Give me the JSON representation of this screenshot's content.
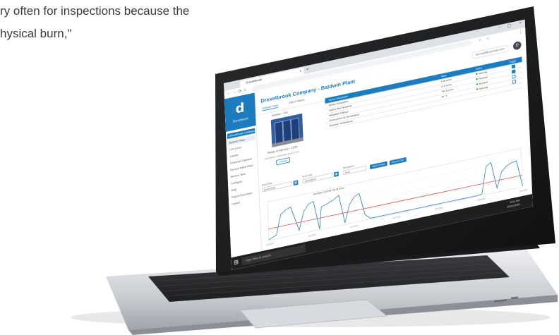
{
  "quote": {
    "line1": "ry often for inspections because the",
    "line2": "hysical burn,\""
  },
  "browser": {
    "tab_title": "DrexelBrook",
    "close_tab": "×",
    "new_tab": "+",
    "window_controls": [
      "–",
      "▢",
      "×"
    ]
  },
  "header": {
    "user": "account@domain.com",
    "avatar_initial": "D"
  },
  "sidebar": {
    "brand": "Drexelbrook",
    "items": [
      {
        "label": "Drexelbrook Company",
        "state": "active"
      },
      {
        "label": "Baldwin Plant",
        "state": "sub"
      },
      {
        "label": "Unit Level",
        "state": "normal"
      },
      {
        "label": "Liquids",
        "state": "normal"
      },
      {
        "label": "Universal Cabinets",
        "state": "normal"
      },
      {
        "label": "Service Panel Plant",
        "state": "normal"
      },
      {
        "label": "Service Tank",
        "state": "normal"
      },
      {
        "label": "Configure",
        "state": "normal"
      },
      {
        "label": "Help",
        "state": "normal"
      },
      {
        "label": "Report Document",
        "state": "normal"
      },
      {
        "label": "Logout",
        "state": "normal"
      }
    ]
  },
  "page": {
    "title": "Drexelbrook Company - Baldwin Plant",
    "tabs": [
      "Baldwin Plant",
      "Alarm History"
    ]
  },
  "photo": {
    "label": "Baldwin - 400",
    "caption": "Rows of Service - 1234",
    "subcaption": "Last Refresh: 10/21/2020 10:52:17 PM",
    "button": "Refresh"
  },
  "table": {
    "headers": [
      "Sensor Description",
      "Value",
      "Status",
      "Toggle"
    ],
    "rows": [
      {
        "name": "Sensor Description",
        "value": "6.38 kV/m",
        "status": "Nominal",
        "checked": true
      },
      {
        "name": "Carbon Bed Temperat.",
        "value": "6.37 kV/m",
        "status": "Nominal",
        "checked": true
      },
      {
        "name": "Weighted Pollution",
        "value": "760 Cu/mm",
        "status": "Nominal",
        "checked": false
      },
      {
        "name": "Environment Air Temperature",
        "value": "90 °F",
        "status": "Nominal",
        "checked": false
      },
      {
        "name": "Elevation Temperature",
        "value": "",
        "status": "",
        "checked": false
      }
    ]
  },
  "filters": {
    "start_label": "Start Date",
    "start_value": "10/14/2020",
    "end_label": "End Date",
    "end_value": "10/20/2020",
    "resolution_label": "Resolution",
    "resolution_value": "Hour",
    "apply_button": "Apply Graph",
    "export_button": "Export CSV",
    "calendar_icon": "calendar-icon"
  },
  "chart_data": {
    "type": "line",
    "series": [
      {
        "name": "",
        "color": "#2f80c8",
        "x": [
          0,
          3,
          5,
          7,
          9,
          12,
          14,
          16,
          18,
          20,
          21,
          23,
          26,
          28,
          30,
          32,
          34,
          36,
          38,
          40,
          42,
          44,
          46,
          48,
          50,
          52,
          54,
          56,
          58,
          60,
          62,
          64,
          66,
          68,
          70,
          72,
          74,
          76,
          78,
          80,
          82,
          84,
          86,
          88,
          90,
          92,
          94,
          96,
          98,
          100
        ],
        "values": [
          2,
          10,
          60,
          70,
          74,
          10,
          55,
          72,
          76,
          2,
          58,
          62,
          70,
          78,
          4,
          48,
          66,
          72,
          14,
          2,
          2,
          2,
          2,
          2,
          2,
          2,
          2,
          2,
          2,
          2,
          2,
          2,
          2,
          2,
          2,
          2,
          2,
          2,
          2,
          2,
          2,
          4,
          72,
          80,
          10,
          50,
          62,
          68,
          70,
          2
        ]
      },
      {
        "name": "",
        "color": "#d9534f",
        "x": [
          0,
          10,
          20,
          30,
          40,
          50,
          60,
          70,
          80,
          90,
          100
        ],
        "values": [
          30,
          30,
          30,
          30,
          30,
          30,
          30,
          30,
          30,
          30,
          30
        ]
      }
    ],
    "ylim": [
      0,
      100
    ],
    "annotation": "10/14/20 2:00 PM, 66.38 kV/m",
    "x_ticks": [
      "12/14/20",
      "12/15/20",
      "12/16/20",
      "12/17/20",
      "12/18/20",
      "12/19/20",
      "12/20/20"
    ]
  },
  "taskbar": {
    "search_placeholder": "Type here to search",
    "time": "9:21 AM",
    "date": "10/21/2020"
  }
}
